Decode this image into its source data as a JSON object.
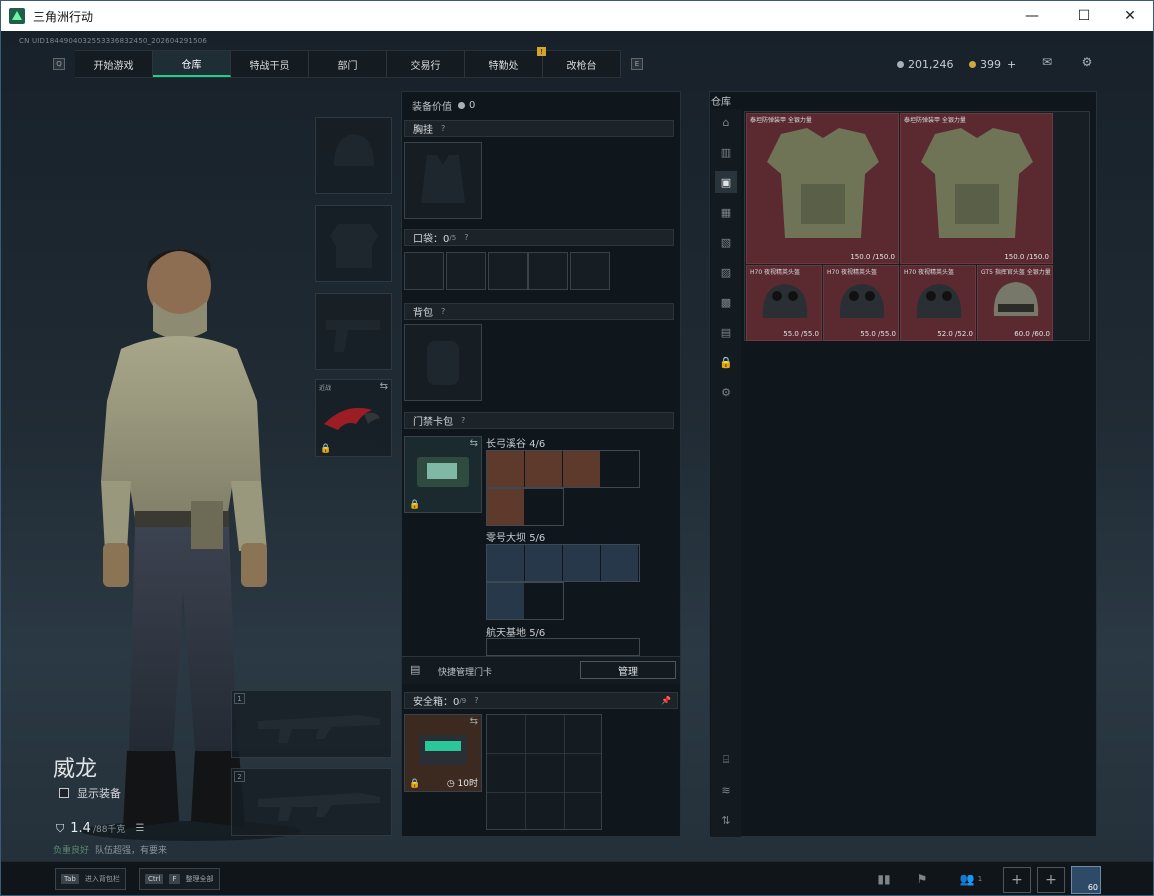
{
  "window": {
    "title": "三角洲行动",
    "minimize": "—",
    "maximize": "☐",
    "close": "✕"
  },
  "header": {
    "uid": "CN UID1844904032553336832450_202604291506",
    "key_left": "Q",
    "key_right": "E",
    "tabs": [
      "开始游戏",
      "仓库",
      "特战干员",
      "部门",
      "交易行",
      "特勤处",
      "改枪台"
    ],
    "active_tab": 1,
    "notice_badge": "!",
    "silver": "201,246",
    "gold": "399",
    "gold_plus": "+"
  },
  "character": {
    "name": "威龙",
    "show_gear_label": "显示装备",
    "weight": "1.4",
    "weight_max": "/88千克",
    "tip_green": "负重良好",
    "tip_gray": "队伍超强，有要来"
  },
  "gear_slots": {
    "melee_label": "近战",
    "weapon1_index": "1",
    "weapon2_index": "2"
  },
  "loadout": {
    "value_label": "装备价值",
    "value": "0",
    "chest_rig": "胸挂",
    "pocket": "口袋：0",
    "pocket_max": "/5",
    "backpack": "背包",
    "keycard_bag": "门禁卡包",
    "maps": [
      {
        "name": "长弓溪谷",
        "count": "4/6"
      },
      {
        "name": "零号大坝",
        "count": "5/6"
      },
      {
        "name": "航天基地",
        "count": "5/6"
      }
    ],
    "quick_manage": "快捷管理门卡",
    "manage_button": "管理",
    "safebox": "安全箱：0",
    "safebox_max": "/9",
    "safebox_timer": "10时",
    "help": "?"
  },
  "storage": {
    "title": "仓库",
    "items": [
      {
        "name": "泰坦防弹装甲 全银力量",
        "durability": "150.0 /150.0"
      },
      {
        "name": "泰坦防弹装甲 全银力量",
        "durability": "150.0 /150.0"
      },
      {
        "name": "H70 夜视精英头盔",
        "durability": "55.0 /55.0"
      },
      {
        "name": "H70 夜视精英头盔",
        "durability": "55.0 /55.0"
      },
      {
        "name": "H70 夜视精英头盔",
        "durability": "52.0 /52.0"
      },
      {
        "name": "GT5 指挥官头盔 全银力量",
        "durability": "60.0 /60.0"
      }
    ]
  },
  "bottom": {
    "tab_key": "Tab",
    "tab_label": "进入背包栏",
    "ctrl_key": "Ctrl",
    "f_key": "F",
    "ctrl_label": "整理全部",
    "squad_count": "1",
    "avatar_level": "60"
  },
  "colors": {
    "accent": "#1fd08a",
    "rare_red": "#5a2a30",
    "panel": "#10171c"
  }
}
